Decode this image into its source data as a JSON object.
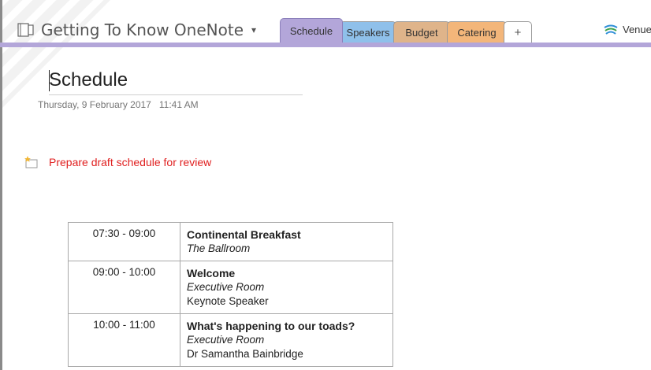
{
  "notebook": {
    "title": "Getting To Know OneNote",
    "dropdown_caret": "▾"
  },
  "tabs": [
    {
      "label": "Schedule",
      "active": true,
      "color": "#b3a6d9"
    },
    {
      "label": "Speakers",
      "active": false,
      "color": "#8fc0ea"
    },
    {
      "label": "Budget",
      "active": false,
      "color": "#dfb48a"
    },
    {
      "label": "Catering",
      "active": false,
      "color": "#f3b67a"
    },
    {
      "label": "+",
      "active": false,
      "color": "#ffffff"
    }
  ],
  "venue_link": {
    "label": "Venue",
    "icon": "venue-icon"
  },
  "page": {
    "title": "Schedule",
    "date": "Thursday, 9 February 2017",
    "time": "11:41 AM"
  },
  "task": {
    "label": "Prepare draft schedule for review",
    "icon": "task-flag-icon",
    "color": "#e02020"
  },
  "schedule": [
    {
      "time": "07:30 - 09:00",
      "title": "Continental Breakfast",
      "room": "The Ballroom",
      "speaker": ""
    },
    {
      "time": "09:00 - 10:00",
      "title": "Welcome",
      "room": "Executive Room",
      "speaker": "Keynote Speaker"
    },
    {
      "time": "10:00 - 11:00",
      "title": "What's happening to our toads?",
      "room": "Executive Room",
      "speaker": "Dr Samantha Bainbridge"
    }
  ]
}
